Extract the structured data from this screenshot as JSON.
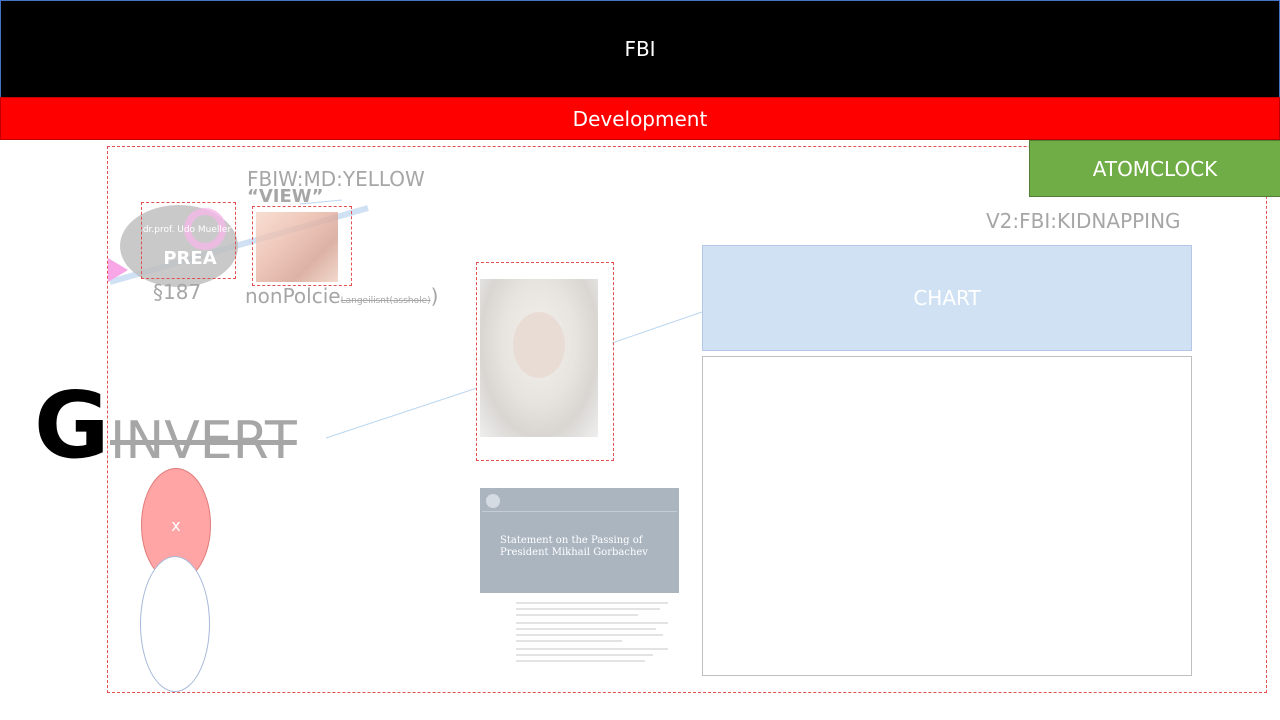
{
  "header": {
    "title": "FBI"
  },
  "subheader": {
    "title": "Development"
  },
  "atomclock": {
    "label": "ATOMCLOCK"
  },
  "labels": {
    "fbiw": "FBIW:MD:YELLOW",
    "view": "“VIEW”",
    "prea": "PREA",
    "drprof": "dr.prof. Udo Mueller",
    "section": "§187",
    "nonpolcie": "nonPolcie",
    "nonpolcie_sub": "Langeilisnt(asshole)",
    "nonpolcie_paren": ")",
    "v2": "V2:FBI:KIDNAPPING",
    "g_letter": "G",
    "invert": "INVERT",
    "oval_x": "x"
  },
  "chart_box": {
    "label": "CHART"
  },
  "article": {
    "title": "Statement on the Passing of President Mikhail Gorbachev"
  },
  "colors": {
    "header_bg": "#000000",
    "subheader_bg": "#ff0000",
    "atomclock_bg": "#70ad47",
    "chart_bg": "#cfe1f3",
    "muted_text": "#a6a6a6",
    "dashed_border": "#e05050"
  }
}
